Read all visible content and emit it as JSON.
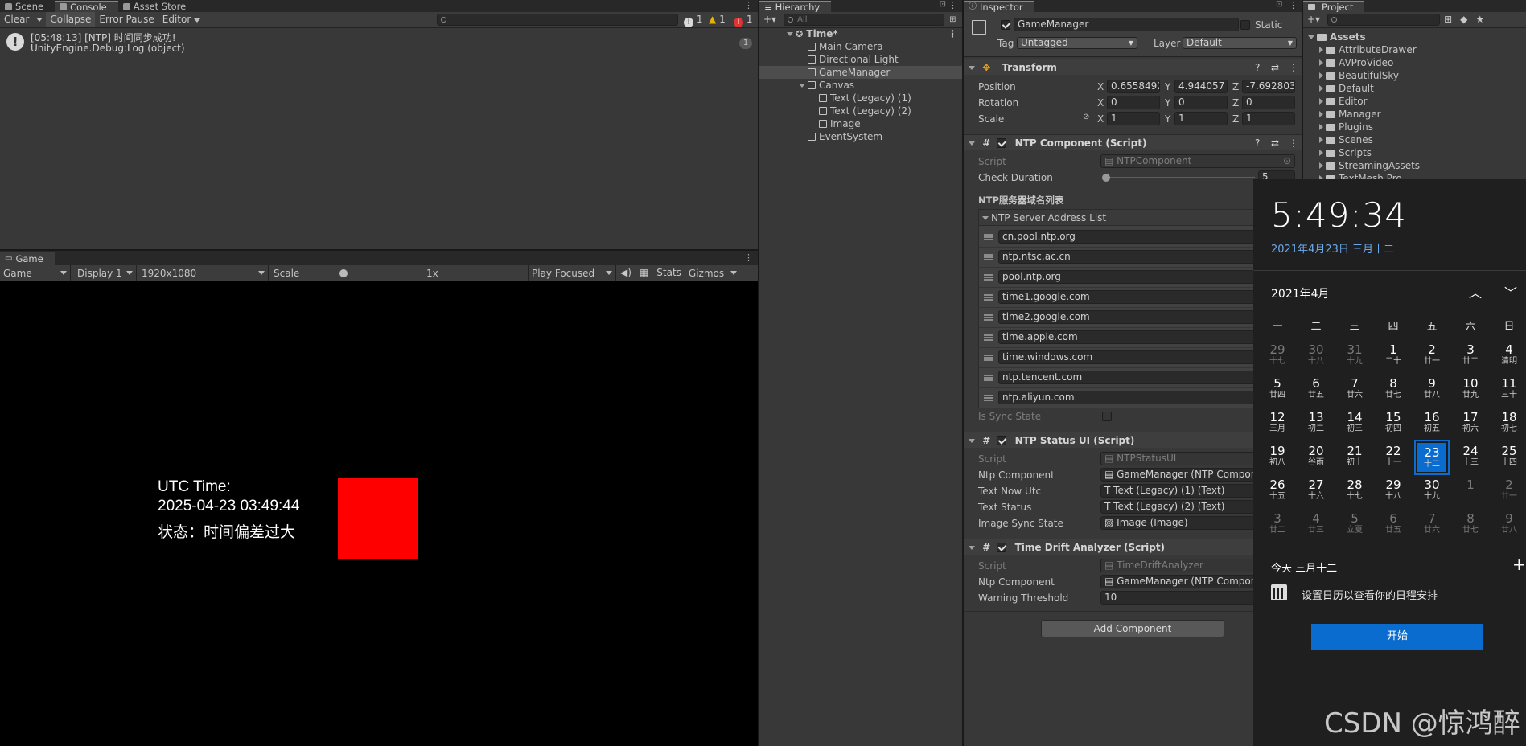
{
  "console": {
    "tabs": [
      "Scene",
      "Console",
      "Asset Store"
    ],
    "toolbar": {
      "clear": "Clear",
      "collapse": "Collapse",
      "error_pause": "Error Pause",
      "editor": "Editor"
    },
    "counts": {
      "info": "1",
      "warn": "1",
      "error": "1"
    },
    "log": {
      "line1": "[05:48:13] [NTP] 时间同步成功!",
      "line2": "UnityEngine.Debug:Log (object)",
      "badge": "1"
    }
  },
  "game": {
    "tab": "Game",
    "toolbar": {
      "view": "Game",
      "display": "Display 1",
      "resolution": "1920x1080",
      "scale_label": "Scale",
      "scale_value": "1x",
      "play_focused": "Play Focused",
      "stats": "Stats",
      "gizmos": "Gizmos"
    },
    "text": {
      "line1": "UTC Time:",
      "line2": "2025-04-23 03:49:44",
      "line3": "状态：时间偏差过大"
    },
    "square_color": "#ff0000"
  },
  "hierarchy": {
    "tab": "Hierarchy",
    "search_placeholder": "All",
    "scene": "Time*",
    "items": [
      "Main Camera",
      "Directional Light",
      "GameManager",
      "Canvas",
      "Text (Legacy) (1)",
      "Text (Legacy) (2)",
      "Image",
      "EventSystem"
    ]
  },
  "inspector": {
    "tab": "Inspector",
    "object_name": "GameManager",
    "static_label": "Static",
    "tag_label": "Tag",
    "tag_value": "Untagged",
    "layer_label": "Layer",
    "layer_value": "Default",
    "transform": {
      "title": "Transform",
      "position_label": "Position",
      "rotation_label": "Rotation",
      "scale_label": "Scale",
      "position": [
        "0.6558492",
        "4.944057",
        "-7.692803"
      ],
      "rotation": [
        "0",
        "0",
        "0"
      ],
      "scale": [
        "1",
        "1",
        "1"
      ],
      "axes": [
        "X",
        "Y",
        "Z"
      ]
    },
    "ntp_component": {
      "title": "NTP Component (Script)",
      "script_label": "Script",
      "script_value": "NTPComponent",
      "check_duration_label": "Check Duration",
      "check_duration_value": "5",
      "list_header": "NTP服务器域名列表",
      "list_label": "NTP Server Address List",
      "list_count": "9",
      "servers": [
        "cn.pool.ntp.org",
        "ntp.ntsc.ac.cn",
        "pool.ntp.org",
        "time1.google.com",
        "time2.google.com",
        "time.apple.com",
        "time.windows.com",
        "ntp.tencent.com",
        "ntp.aliyun.com"
      ],
      "sync_label": "Is Sync State"
    },
    "ntp_status": {
      "title": "NTP Status UI (Script)",
      "script_label": "Script",
      "script_value": "NTPStatusUI",
      "ntp_label": "Ntp Component",
      "ntp_value": "GameManager (NTP Compone",
      "now_label": "Text Now Utc",
      "now_value": "Text (Legacy) (1) (Text)",
      "status_label": "Text Status",
      "status_value": "Text (Legacy) (2) (Text)",
      "image_label": "Image Sync State",
      "image_value": "Image (Image)"
    },
    "drift": {
      "title": "Time Drift Analyzer (Script)",
      "script_label": "Script",
      "script_value": "TimeDriftAnalyzer",
      "ntp_label": "Ntp Component",
      "ntp_value": "GameManager (NTP Compone",
      "warn_label": "Warning Threshold",
      "warn_value": "10"
    },
    "add_component": "Add Component"
  },
  "project": {
    "tab": "Project",
    "root": "Assets",
    "folders": [
      "AttributeDrawer",
      "AVProVideo",
      "BeautifulSky",
      "Default",
      "Editor",
      "Manager",
      "Plugins",
      "Scenes",
      "Scripts",
      "StreamingAssets",
      "TextMesh Pro"
    ]
  },
  "calendar": {
    "time": "5:49:34",
    "date": "2021年4月23日 三月十二",
    "month": "2021年4月",
    "weekdays": [
      "一",
      "二",
      "三",
      "四",
      "五",
      "六",
      "日"
    ],
    "days": [
      [
        "29",
        "十七",
        1
      ],
      [
        "30",
        "十八",
        1
      ],
      [
        "31",
        "十九",
        1
      ],
      [
        "1",
        "二十",
        0
      ],
      [
        "2",
        "廿一",
        0
      ],
      [
        "3",
        "廿二",
        0
      ],
      [
        "4",
        "清明",
        0
      ],
      [
        "5",
        "廿四",
        0
      ],
      [
        "6",
        "廿五",
        0
      ],
      [
        "7",
        "廿六",
        0
      ],
      [
        "8",
        "廿七",
        0
      ],
      [
        "9",
        "廿八",
        0
      ],
      [
        "10",
        "廿九",
        0
      ],
      [
        "11",
        "三十",
        0
      ],
      [
        "12",
        "三月",
        0
      ],
      [
        "13",
        "初二",
        0
      ],
      [
        "14",
        "初三",
        0
      ],
      [
        "15",
        "初四",
        0
      ],
      [
        "16",
        "初五",
        0
      ],
      [
        "17",
        "初六",
        0
      ],
      [
        "18",
        "初七",
        0
      ],
      [
        "19",
        "初八",
        0
      ],
      [
        "20",
        "谷雨",
        0
      ],
      [
        "21",
        "初十",
        0
      ],
      [
        "22",
        "十一",
        0
      ],
      [
        "23",
        "十二",
        2
      ],
      [
        "24",
        "十三",
        0
      ],
      [
        "25",
        "十四",
        0
      ],
      [
        "26",
        "十五",
        0
      ],
      [
        "27",
        "十六",
        0
      ],
      [
        "28",
        "十七",
        0
      ],
      [
        "29",
        "十八",
        0
      ],
      [
        "30",
        "十九",
        0
      ],
      [
        "1",
        "",
        1
      ],
      [
        "2",
        "廿一",
        1
      ],
      [
        "3",
        "廿二",
        1
      ],
      [
        "4",
        "廿三",
        1
      ],
      [
        "5",
        "立夏",
        1
      ],
      [
        "6",
        "廿五",
        1
      ],
      [
        "7",
        "廿六",
        1
      ],
      [
        "8",
        "廿七",
        1
      ],
      [
        "9",
        "廿八",
        1
      ]
    ],
    "today": "今天 三月十二",
    "empty_text": "设置日历以查看你的日程安排",
    "start_button": "开始",
    "accent": "#0a6ccf"
  },
  "watermark": "CSDN @惊鸿醉"
}
